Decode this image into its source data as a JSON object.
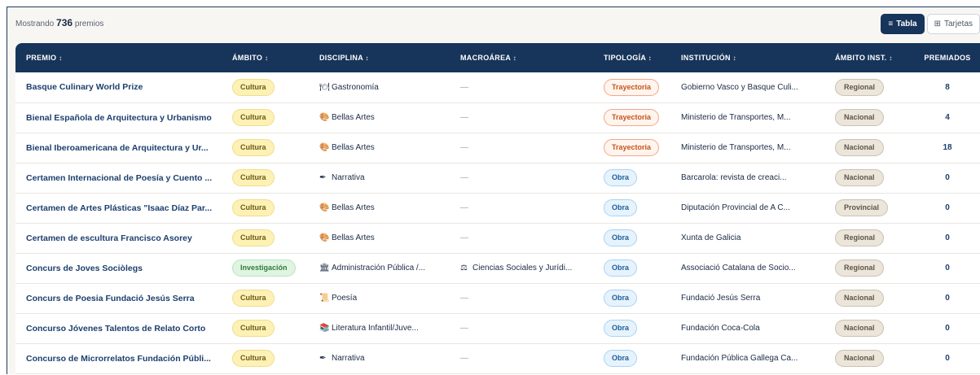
{
  "header": {
    "count_prefix": "Mostrando",
    "count_value": "736",
    "count_suffix": "premios",
    "view_table_label": "Tabla",
    "view_cards_label": "Tarjetas"
  },
  "columns": [
    {
      "label": "PREMIO",
      "sort": "↕"
    },
    {
      "label": "ÁMBITO",
      "sort": "↕"
    },
    {
      "label": "DISCIPLINA",
      "sort": "↕"
    },
    {
      "label": "MACROÁREA",
      "sort": "↕"
    },
    {
      "label": "TIPOLOGÍA",
      "sort": "↕"
    },
    {
      "label": "INSTITUCIÓN",
      "sort": "↕"
    },
    {
      "label": "ÁMBITO INST.",
      "sort": "↕"
    },
    {
      "label": "PREMIADOS",
      "sort": ""
    }
  ],
  "rows": [
    {
      "premio": "Basque Culinary World Prize",
      "ambito": "Cultura",
      "disciplina_icon": "🍽",
      "disciplina": "Gastronomía",
      "macroarea_icon": "",
      "macroarea": "—",
      "tipologia": "Trayectoria",
      "institucion": "Gobierno Vasco y Basque Culi...",
      "ambito_inst": "Regional",
      "premiados": "8"
    },
    {
      "premio": "Bienal Española de Arquitectura y Urbanismo",
      "ambito": "Cultura",
      "disciplina_icon": "🎨",
      "disciplina": "Bellas Artes",
      "macroarea_icon": "",
      "macroarea": "—",
      "tipologia": "Trayectoria",
      "institucion": "Ministerio de Transportes, M...",
      "ambito_inst": "Nacional",
      "premiados": "4"
    },
    {
      "premio": "Bienal Iberoamericana de Arquitectura y Ur...",
      "ambito": "Cultura",
      "disciplina_icon": "🎨",
      "disciplina": "Bellas Artes",
      "macroarea_icon": "",
      "macroarea": "—",
      "tipologia": "Trayectoria",
      "institucion": "Ministerio de Transportes, M...",
      "ambito_inst": "Nacional",
      "premiados": "18"
    },
    {
      "premio": "Certamen Internacional de Poesía y Cuento ...",
      "ambito": "Cultura",
      "disciplina_icon": "✒",
      "disciplina": "Narrativa",
      "macroarea_icon": "",
      "macroarea": "—",
      "tipologia": "Obra",
      "institucion": "Barcarola: revista de creaci...",
      "ambito_inst": "Nacional",
      "premiados": "0"
    },
    {
      "premio": "Certamen de Artes Plásticas \"Isaac Díaz Par...",
      "ambito": "Cultura",
      "disciplina_icon": "🎨",
      "disciplina": "Bellas Artes",
      "macroarea_icon": "",
      "macroarea": "—",
      "tipologia": "Obra",
      "institucion": "Diputación Provincial de A C...",
      "ambito_inst": "Provincial",
      "premiados": "0"
    },
    {
      "premio": "Certamen de escultura Francisco Asorey",
      "ambito": "Cultura",
      "disciplina_icon": "🎨",
      "disciplina": "Bellas Artes",
      "macroarea_icon": "",
      "macroarea": "—",
      "tipologia": "Obra",
      "institucion": "Xunta de Galicia",
      "ambito_inst": "Regional",
      "premiados": "0"
    },
    {
      "premio": "Concurs de Joves Sociòlegs",
      "ambito": "Investigación",
      "disciplina_icon": "🏛",
      "disciplina": "Administración Pública /...",
      "macroarea_icon": "⚖",
      "macroarea": "Ciencias Sociales y Jurídi...",
      "tipologia": "Obra",
      "institucion": "Associació Catalana de Socio...",
      "ambito_inst": "Regional",
      "premiados": "0"
    },
    {
      "premio": "Concurs de Poesia Fundació Jesús Serra",
      "ambito": "Cultura",
      "disciplina_icon": "📜",
      "disciplina": "Poesía",
      "macroarea_icon": "",
      "macroarea": "—",
      "tipologia": "Obra",
      "institucion": "Fundació Jesús Serra",
      "ambito_inst": "Nacional",
      "premiados": "0"
    },
    {
      "premio": "Concurso Jóvenes Talentos de Relato Corto",
      "ambito": "Cultura",
      "disciplina_icon": "📚",
      "disciplina": "Literatura Infantil/Juve...",
      "macroarea_icon": "",
      "macroarea": "—",
      "tipologia": "Obra",
      "institucion": "Fundación Coca-Cola",
      "ambito_inst": "Nacional",
      "premiados": "0"
    },
    {
      "premio": "Concurso de Microrrelatos Fundación Públi...",
      "ambito": "Cultura",
      "disciplina_icon": "✒",
      "disciplina": "Narrativa",
      "macroarea_icon": "",
      "macroarea": "—",
      "tipologia": "Obra",
      "institucion": "Fundación Pública Gallega Ca...",
      "ambito_inst": "Nacional",
      "premiados": "0"
    }
  ]
}
